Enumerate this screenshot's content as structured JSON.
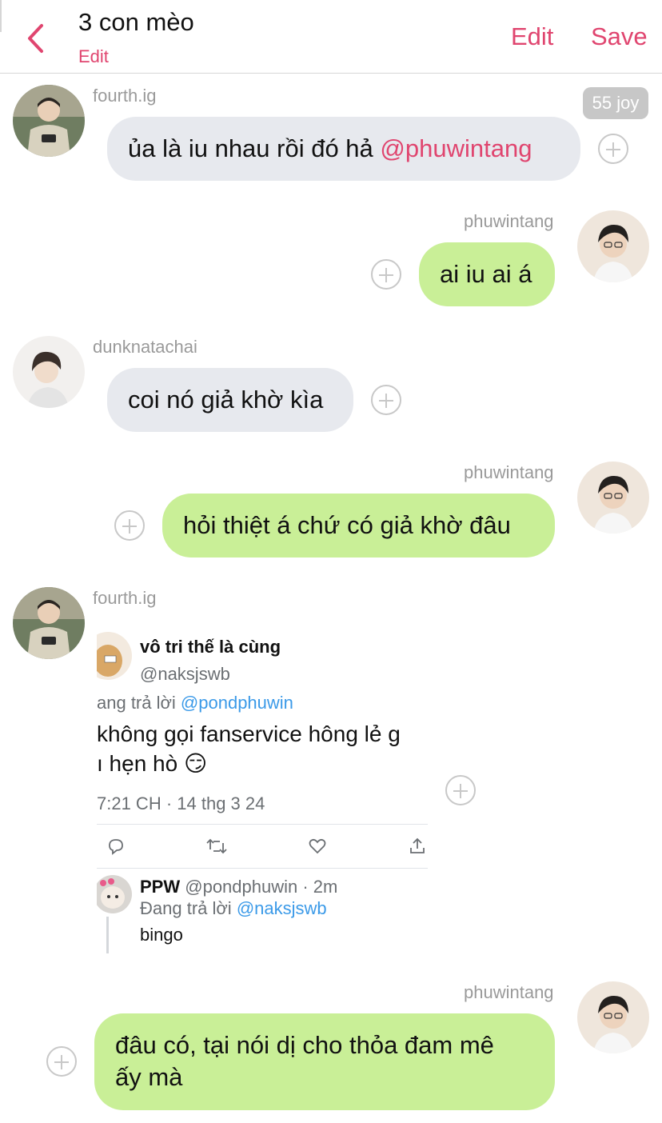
{
  "header": {
    "title": "3 con mèo",
    "sub_edit": "Edit",
    "edit_label": "Edit",
    "save_label": "Save"
  },
  "joy_badge": "55 joy",
  "messages": [
    {
      "user": "fourth.ig",
      "text": "ủa là iu nhau rồi đó hả ",
      "mention": "@phuwintang"
    },
    {
      "user": "phuwintang",
      "text": "ai iu ai á"
    },
    {
      "user": "dunknatachai",
      "text": "coi nó giả khờ kìa"
    },
    {
      "user": "phuwintang",
      "text": "hỏi thiệt á chứ có giả khờ đâu"
    },
    {
      "user": "fourth.ig"
    },
    {
      "user": "phuwintang",
      "text_line1": "đâu có, tại nói dị cho thỏa đam mê",
      "text_line2": "ấy mà"
    }
  ],
  "tweet": {
    "name": "vô tri thế là cùng",
    "handle": "@naksjswb",
    "reply_prefix": "ang trả lời ",
    "reply_to": "@pondphuwin",
    "line1": "không gọi fanservice hông lẻ g",
    "line2": "ı hẹn hò 😏",
    "meta": "7:21 CH · 14 thg 3 24",
    "reply": {
      "name": "PPW",
      "handle_time": "@pondphuwin · 2m",
      "replying_prefix": "Đang trả lời ",
      "replying_to": "@naksjswb",
      "text": "bingo"
    }
  },
  "colors": {
    "accent": "#e0456f",
    "bubble_left": "#e7e9ee",
    "bubble_right": "#c9ef97",
    "username": "#9a9a9a",
    "tweet_link": "#3b9ae8"
  }
}
